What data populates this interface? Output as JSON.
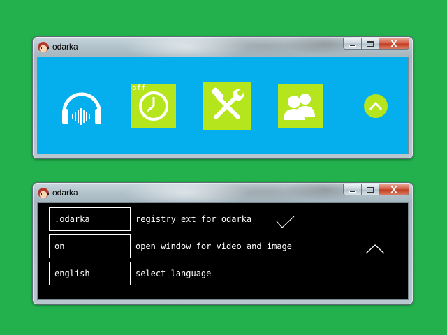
{
  "window_top": {
    "title": "odarka",
    "controls": {
      "minimize": "",
      "maximize": "",
      "close": "X"
    },
    "tiles": [
      {
        "name": "headphones",
        "icon": "headphones-icon"
      },
      {
        "name": "clock",
        "icon": "clock-icon",
        "badge": "off"
      },
      {
        "name": "tools",
        "icon": "hammer-wrench-icon"
      },
      {
        "name": "users",
        "icon": "users-icon"
      },
      {
        "name": "expand",
        "icon": "chevron-up-icon"
      }
    ],
    "colors": {
      "background": "#05aeed",
      "tile": "#b5e61d"
    }
  },
  "window_bottom": {
    "title": "odarka",
    "controls": {
      "minimize": "",
      "maximize": "",
      "close": "X"
    },
    "settings": [
      {
        "value": ".odarka",
        "description": "registry ext for odarka"
      },
      {
        "value": "on",
        "description": "open window for video and image"
      },
      {
        "value": "english",
        "description": "select language"
      }
    ],
    "icons": {
      "confirm": "checkmark-icon",
      "collapse": "chevron-up-icon"
    },
    "colors": {
      "background": "#000000",
      "text": "#ffffff"
    }
  },
  "desktop": {
    "background": "#22b14c"
  }
}
